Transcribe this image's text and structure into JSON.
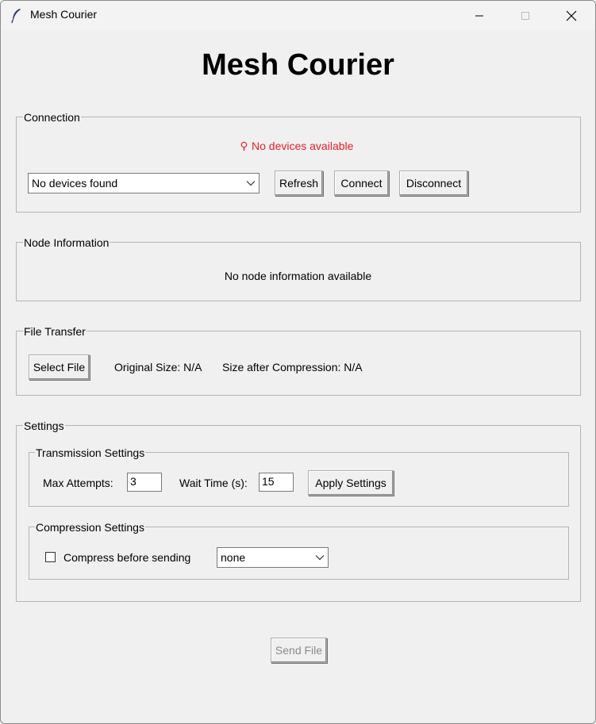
{
  "window": {
    "title": "Mesh Courier"
  },
  "header": {
    "title": "Mesh Courier"
  },
  "connection": {
    "label": "Connection",
    "status": "No devices available",
    "device_select_value": "No devices found",
    "refresh_label": "Refresh",
    "connect_label": "Connect",
    "disconnect_label": "Disconnect",
    "status_color": "#e8202a"
  },
  "node_info": {
    "label": "Node Information",
    "message": "No node information available"
  },
  "file_transfer": {
    "label": "File Transfer",
    "select_label": "Select File",
    "original_size": "Original Size: N/A",
    "compressed_size": "Size after Compression: N/A"
  },
  "settings": {
    "label": "Settings",
    "transmission": {
      "label": "Transmission Settings",
      "max_attempts_label": "Max Attempts:",
      "max_attempts_value": "3",
      "wait_time_label": "Wait Time (s):",
      "wait_time_value": "15",
      "apply_label": "Apply Settings"
    },
    "compression": {
      "label": "Compression Settings",
      "compress_label": "Compress before sending",
      "compress_checked": false,
      "method_value": "none"
    }
  },
  "footer": {
    "send_label": "Send File"
  },
  "icons": {
    "app": "feather-icon",
    "status": "bulb-icon",
    "minimize": "minimize-icon",
    "maximize": "maximize-icon",
    "close": "close-icon",
    "dropdown": "chevron-down-icon"
  }
}
